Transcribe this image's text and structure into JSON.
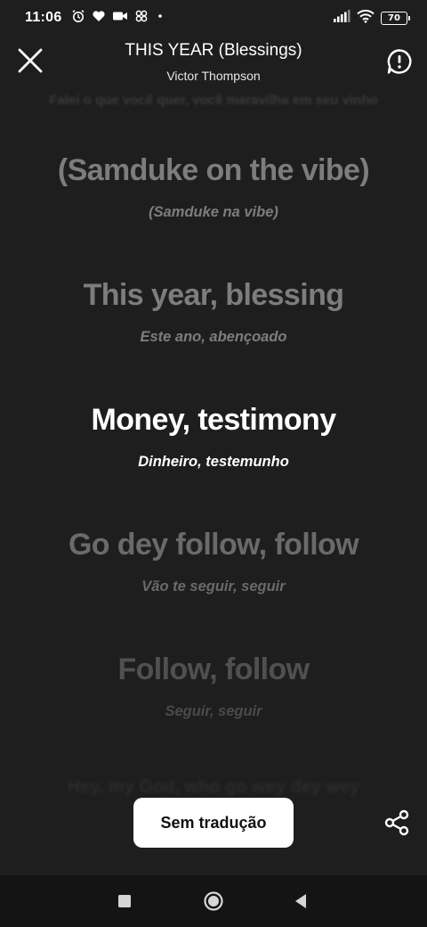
{
  "status_bar": {
    "time": "11:06",
    "battery": "70",
    "left_icons": [
      "alarm-icon",
      "heart-icon",
      "video-icon",
      "app-icon",
      "dot-icon"
    ],
    "right_icons": [
      "signal-icon",
      "wifi-icon",
      "battery-icon"
    ]
  },
  "header": {
    "title": "THIS YEAR (Blessings)",
    "artist": "Victor Thompson",
    "close_icon": "close-icon",
    "report_icon": "report-icon"
  },
  "lyrics": {
    "faint_top": "Falei o que você quer, você maravilha em seu vinho",
    "lines": [
      {
        "text": "(Samduke on the vibe)",
        "translation": "(Samduke na vibe)",
        "state": "past"
      },
      {
        "text": "This year, blessing",
        "translation": "Este ano, abençoado",
        "state": "past"
      },
      {
        "text": "Money, testimony",
        "translation": "Dinheiro, testemunho",
        "state": "current"
      },
      {
        "text": "Go dey follow, follow",
        "translation": "Vão te seguir, seguir",
        "state": "next"
      },
      {
        "text": "Follow, follow",
        "translation": "Seguir, seguir",
        "state": "upcoming"
      }
    ],
    "faint_bottom": "Hey, my God, who go wey dey wey"
  },
  "controls": {
    "translation_toggle_label": "Sem tradução",
    "share_icon": "share-icon"
  },
  "nav_bar": {
    "recents_icon": "recents-icon",
    "home_icon": "home-icon",
    "back_icon": "back-icon"
  },
  "colors": {
    "background": "#1e1e1e",
    "current_line": "#ffffff",
    "past_line": "#7d7d7d",
    "next_line": "#6a6a6a",
    "upcoming_line": "#505050",
    "button_bg": "#ffffff",
    "nav_bar": "#141414"
  }
}
